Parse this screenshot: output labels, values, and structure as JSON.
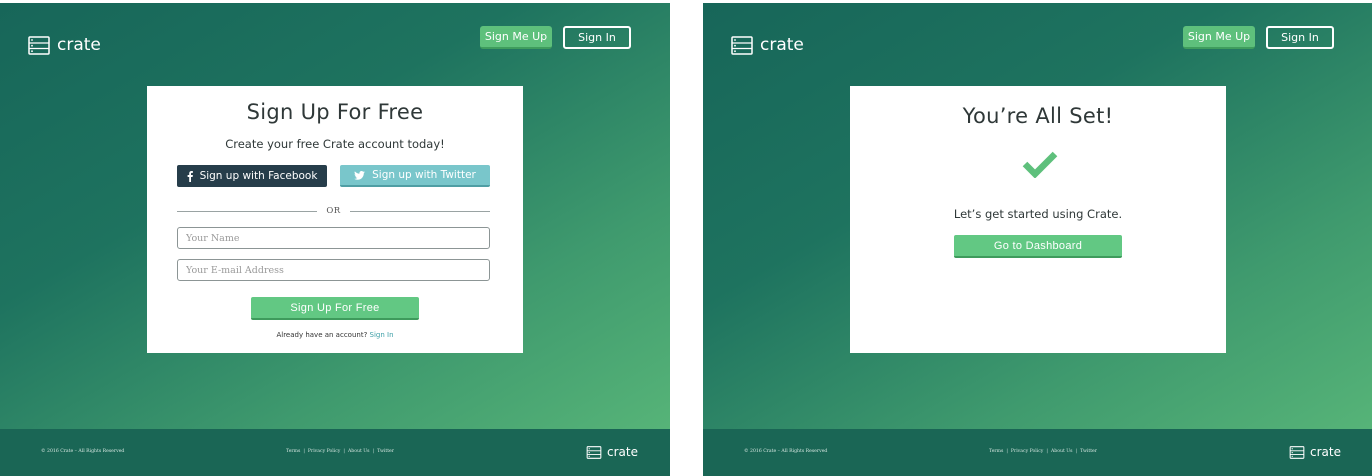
{
  "brand": {
    "name": "crate"
  },
  "colors": {
    "accent_green": "#62c883",
    "teal_dark": "#176659",
    "facebook": "#263d4a",
    "twitter": "#79c6cb",
    "link": "#3fa0a8"
  },
  "header": {
    "signup_label": "Sign Me Up",
    "signin_label": "Sign In"
  },
  "signup_card": {
    "title": "Sign Up For Free",
    "subtitle": "Create your free Crate account today!",
    "facebook_label": "Sign up with Facebook",
    "twitter_label": "Sign up with Twitter",
    "divider_label": "OR",
    "name_placeholder": "Your Name",
    "email_placeholder": "Your E-mail Address",
    "submit_label": "Sign Up For Free",
    "already_text": "Already have an account?",
    "signin_link": "Sign In"
  },
  "success_card": {
    "title": "You’re All Set!",
    "message": "Let’s get started using Crate.",
    "dashboard_label": "Go to Dashboard"
  },
  "footer": {
    "copyright": "© 2016 Crate – All Rights Reserved",
    "links": [
      "Terms",
      "Privacy Policy",
      "About Us",
      "Twitter"
    ],
    "separator": "|"
  },
  "icons": [
    "crate-logo-icon",
    "facebook-icon",
    "twitter-icon",
    "checkmark-icon"
  ]
}
